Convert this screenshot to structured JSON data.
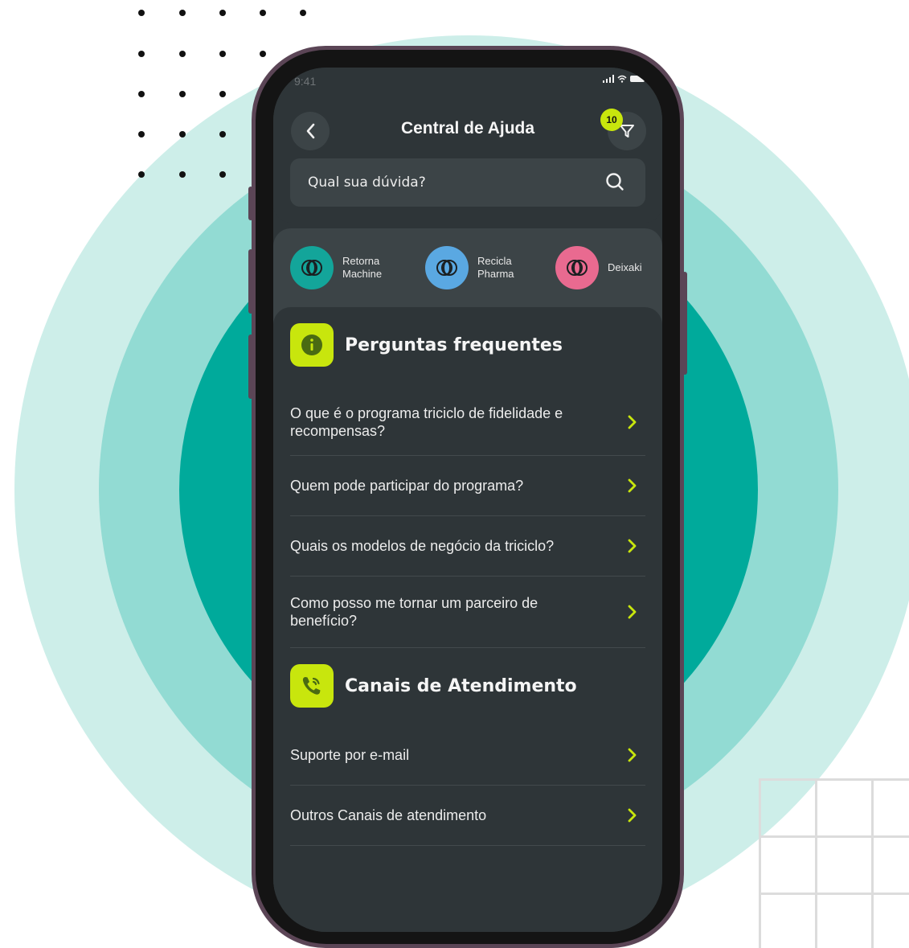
{
  "status_bar": {
    "time": "9:41"
  },
  "header": {
    "title": "Central de Ajuda",
    "filter_badge": "10"
  },
  "search": {
    "placeholder": "Qual sua dúvida?"
  },
  "brands": [
    {
      "label_line1": "Retorna",
      "label_line2": "Machine",
      "color": "#13a59a"
    },
    {
      "label_line1": "Recicla",
      "label_line2": "Pharma",
      "color": "#5aa8e2"
    },
    {
      "label_line1": "Deixaki",
      "label_line2": "",
      "color": "#e96a90"
    }
  ],
  "faq": {
    "title": "Perguntas frequentes",
    "items": [
      {
        "text": "O que é o programa triciclo de fidelidade e recompensas?"
      },
      {
        "text": "Quem pode participar do programa?"
      },
      {
        "text": "Quais os modelos de negócio da triciclo?"
      },
      {
        "text": "Como posso me tornar um parceiro de benefício?"
      }
    ]
  },
  "support": {
    "title": "Canais de Atendimento",
    "items": [
      {
        "text": "Suporte por e-mail"
      },
      {
        "text": "Outros Canais de atendimento"
      }
    ]
  },
  "colors": {
    "accent": "#c8e60d",
    "screen_bg": "#2e3538",
    "card_bg": "#3c4447",
    "teal": "#00aa9b"
  }
}
